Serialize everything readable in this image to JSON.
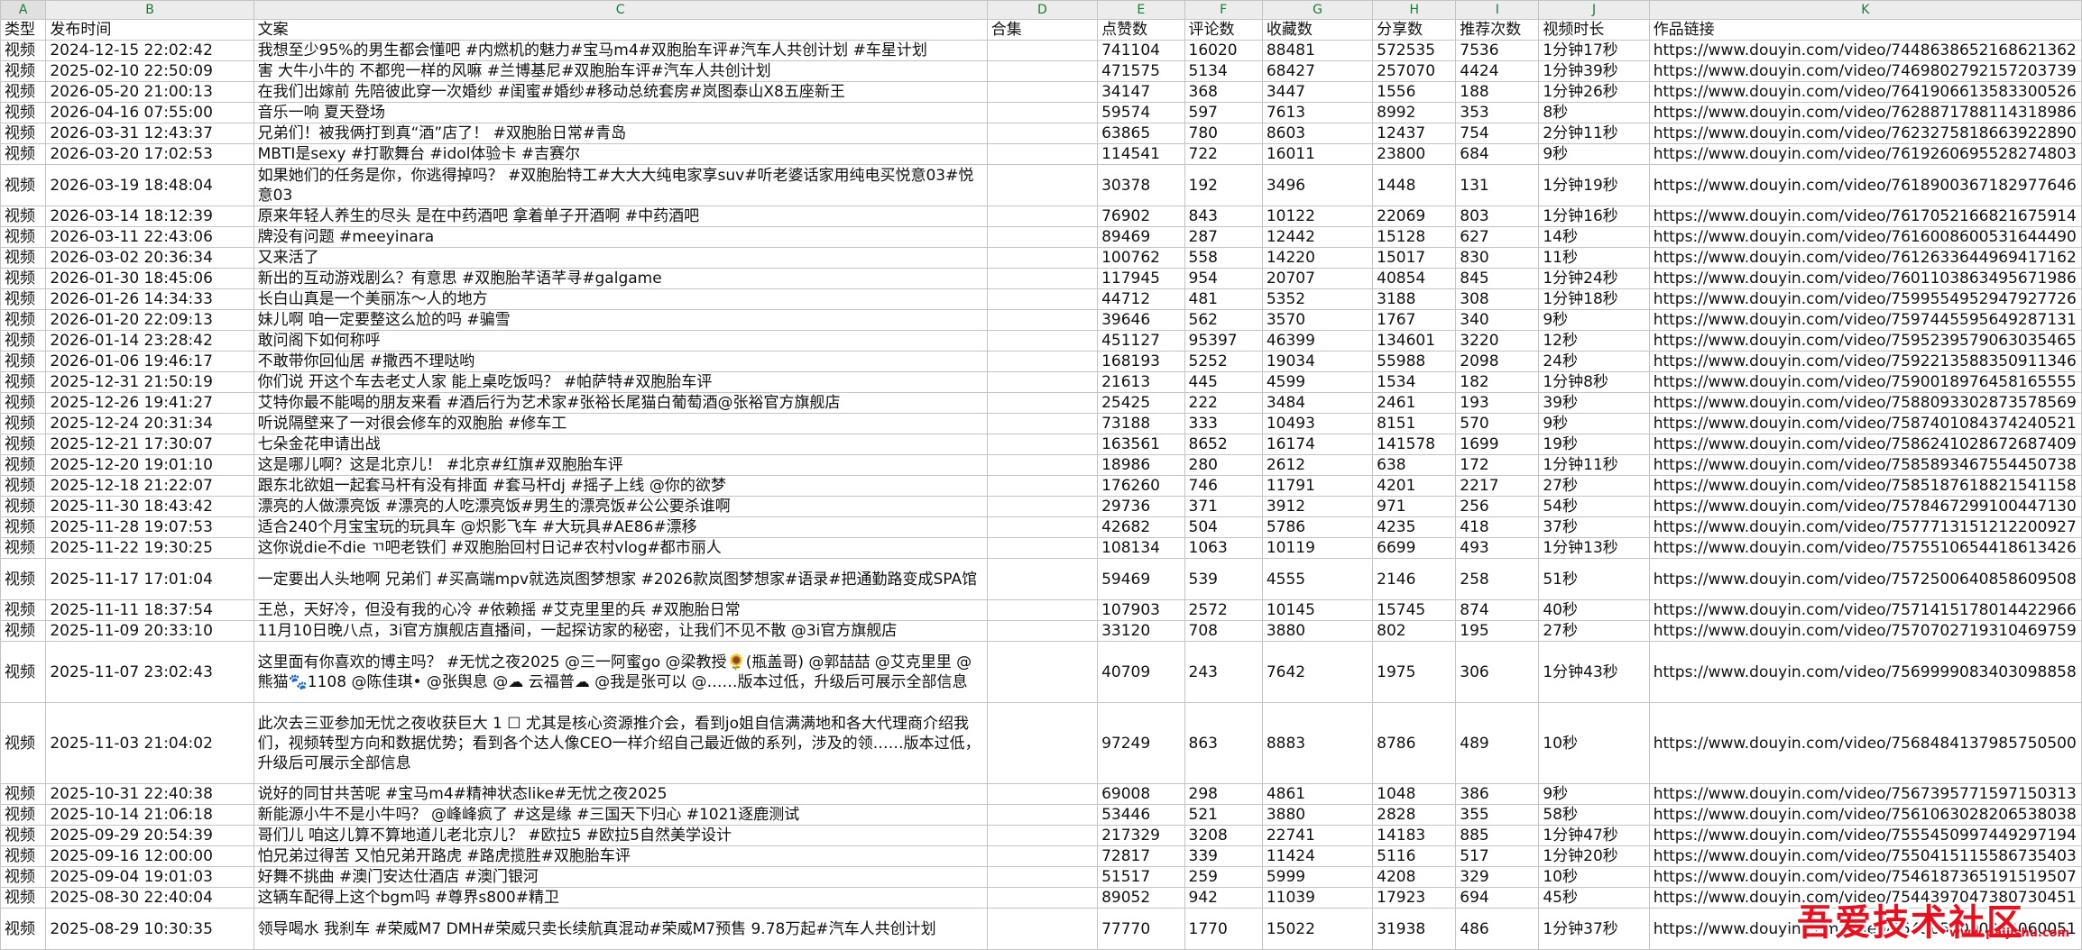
{
  "sheet": {
    "column_letters": [
      "A",
      "B",
      "C",
      "D",
      "E",
      "F",
      "G",
      "H",
      "I",
      "J",
      "K"
    ],
    "headers": [
      "类型",
      "发布时间",
      "文案",
      "合集",
      "点赞数",
      "评论数",
      "收藏数",
      "分享数",
      "推荐次数",
      "视频时长",
      "作品链接"
    ],
    "rows": [
      [
        "视频",
        "2024-12-15 22:02:42",
        "我想至少95%的男生都会懂吧 #内燃机的魅力#宝马m4#双胞胎车评#汽车人共创计划 #车星计划",
        "",
        "741104",
        "16020",
        "88481",
        "572535",
        "7536",
        "1分钟17秒",
        "https://www.douyin.com/video/7448638652168621362"
      ],
      [
        "视频",
        "2025-02-10 22:50:09",
        "害 大牛小牛的 不都兜一样的风嘛 #兰博基尼#双胞胎车评#汽车人共创计划",
        "",
        "471575",
        "5134",
        "68427",
        "257070",
        "4424",
        "1分钟39秒",
        "https://www.douyin.com/video/7469802792157203739"
      ],
      [
        "视频",
        "2026-05-20 21:00:13",
        "在我们出嫁前 先陪彼此穿一次婚纱 #闺蜜#婚纱#移动总统套房#岚图泰山X8五座新王",
        "",
        "34147",
        "368",
        "3447",
        "1556",
        "188",
        "1分钟26秒",
        "https://www.douyin.com/video/7641906613583300526"
      ],
      [
        "视频",
        "2026-04-16 07:55:00",
        "音乐一响 夏天登场",
        "",
        "59574",
        "597",
        "7613",
        "8992",
        "353",
        "8秒",
        "https://www.douyin.com/video/7628871788114318986"
      ],
      [
        "视频",
        "2026-03-31 12:43:37",
        "兄弟们！被我俩打到真“酒”店了！ #双胞胎日常#青岛",
        "",
        "63865",
        "780",
        "8603",
        "12437",
        "754",
        "2分钟11秒",
        "https://www.douyin.com/video/7623275818663922890"
      ],
      [
        "视频",
        "2026-03-20 17:02:53",
        "MBTI是sexy #打歌舞台 #idol体验卡 #吉赛尔",
        "",
        "114541",
        "722",
        "16011",
        "23800",
        "684",
        "9秒",
        "https://www.douyin.com/video/7619260695528274803"
      ],
      [
        "视频",
        "2026-03-19 18:48:04",
        "如果她们的任务是你，你逃得掉吗？ #双胞胎特工#大大大纯电家享suv#听老婆话家用纯电买悦意03#悦意03",
        "",
        "30378",
        "192",
        "3496",
        "1448",
        "131",
        "1分钟19秒",
        "https://www.douyin.com/video/7618900367182977646"
      ],
      [
        "视频",
        "2026-03-14 18:12:39",
        "原来年轻人养生的尽头 是在中药酒吧 拿着单子开酒啊 #中药酒吧",
        "",
        "76902",
        "843",
        "10122",
        "22069",
        "803",
        "1分钟16秒",
        "https://www.douyin.com/video/7617052166821675914"
      ],
      [
        "视频",
        "2026-03-11 22:43:06",
        "牌没有问题 #meeyinara",
        "",
        "89469",
        "287",
        "12442",
        "15128",
        "627",
        "14秒",
        "https://www.douyin.com/video/7616008600531644490"
      ],
      [
        "视频",
        "2026-03-02 20:36:34",
        "又来活了",
        "",
        "100762",
        "558",
        "14220",
        "15017",
        "830",
        "11秒",
        "https://www.douyin.com/video/7612633644969417162"
      ],
      [
        "视频",
        "2026-01-30 18:45:06",
        "新出的互动游戏剧么？有意思 #双胞胎芊语芊寻#galgame",
        "",
        "117945",
        "954",
        "20707",
        "40854",
        "845",
        "1分钟24秒",
        "https://www.douyin.com/video/7601103863495671986"
      ],
      [
        "视频",
        "2026-01-26 14:34:33",
        "长白山真是一个美丽冻～人的地方",
        "",
        "44712",
        "481",
        "5352",
        "3188",
        "308",
        "1分钟18秒",
        "https://www.douyin.com/video/7599554952947927726"
      ],
      [
        "视频",
        "2026-01-20 22:09:13",
        "妹儿啊 咱一定要整这么尬的吗 #骗雪",
        "",
        "39646",
        "562",
        "3570",
        "1767",
        "340",
        "9秒",
        "https://www.douyin.com/video/7597445595649287131"
      ],
      [
        "视频",
        "2026-01-14 23:28:42",
        "敢问阁下如何称呼",
        "",
        "451127",
        "95397",
        "46399",
        "134601",
        "3220",
        "12秒",
        "https://www.douyin.com/video/7595239579063035465"
      ],
      [
        "视频",
        "2026-01-06 19:46:17",
        "不敢带你回仙居 #撒西不理哒哟",
        "",
        "168193",
        "5252",
        "19034",
        "55988",
        "2098",
        "24秒",
        "https://www.douyin.com/video/7592213588350911346"
      ],
      [
        "视频",
        "2025-12-31 21:50:19",
        "你们说 开这个车去老丈人家 能上桌吃饭吗？ #帕萨特#双胞胎车评",
        "",
        "21613",
        "445",
        "4599",
        "1534",
        "182",
        "1分钟8秒",
        "https://www.douyin.com/video/7590018976458165555"
      ],
      [
        "视频",
        "2025-12-26 19:41:27",
        "艾特你最不能喝的朋友来看 #酒后行为艺术家#张裕长尾猫白葡萄酒@张裕官方旗舰店",
        "",
        "25425",
        "222",
        "3484",
        "2461",
        "193",
        "39秒",
        "https://www.douyin.com/video/7588093302873578569"
      ],
      [
        "视频",
        "2025-12-24 20:31:34",
        "听说隔壁来了一对很会修车的双胞胎 #修车工",
        "",
        "73188",
        "333",
        "10493",
        "8151",
        "570",
        "9秒",
        "https://www.douyin.com/video/7587401084374240521"
      ],
      [
        "视频",
        "2025-12-21 17:30:07",
        "七朵金花申请出战",
        "",
        "163561",
        "8652",
        "16174",
        "141578",
        "1699",
        "19秒",
        "https://www.douyin.com/video/7586241028672687409"
      ],
      [
        "视频",
        "2025-12-20 19:01:10",
        "这是哪儿啊？这是北京儿！ #北京#红旗#双胞胎车评",
        "",
        "18986",
        "280",
        "2612",
        "638",
        "172",
        "1分钟11秒",
        "https://www.douyin.com/video/7585893467554450738"
      ],
      [
        "视频",
        "2025-12-18 21:22:07",
        "跟东北欲姐一起套马杆有没有排面 #套马杆dj #摇子上线 @你的欲梦",
        "",
        "176260",
        "746",
        "11791",
        "4201",
        "2217",
        "27秒",
        "https://www.douyin.com/video/7585187618821541158"
      ],
      [
        "视频",
        "2025-11-30 18:43:42",
        "漂亮的人做漂亮饭 #漂亮的人吃漂亮饭#男生的漂亮饭#公公要杀谁啊",
        "",
        "29736",
        "371",
        "3912",
        "971",
        "256",
        "54秒",
        "https://www.douyin.com/video/7578467299100447130"
      ],
      [
        "视频",
        "2025-11-28 19:07:53",
        "适合240个月宝宝玩的玩具车 @炽影飞车 #大玩具#AE86#漂移",
        "",
        "42682",
        "504",
        "5786",
        "4235",
        "418",
        "37秒",
        "https://www.douyin.com/video/7577713151212200927"
      ],
      [
        "视频",
        "2025-11-22 19:30:25",
        "这你说die不die ㄲ吧老铁们 #双胞胎回村日记#农村vlog#都市丽人",
        "",
        "108134",
        "1063",
        "10119",
        "6699",
        "493",
        "1分钟13秒",
        "https://www.douyin.com/video/7575510654418613426"
      ],
      [
        "视频",
        "2025-11-17 17:01:04",
        "一定要出人头地啊 兄弟们 #买高端mpv就选岚图梦想家 #2026款岚图梦想家#语录#把通勤路变成SPA馆",
        "",
        "59469",
        "539",
        "4555",
        "2146",
        "258",
        "51秒",
        "https://www.douyin.com/video/7572500640858609508"
      ],
      [
        "视频",
        "2025-11-11 18:37:54",
        "王总，天好冷，但没有我的心冷 #依赖摇 #艾克里里的兵 #双胞胎日常",
        "",
        "107903",
        "2572",
        "10145",
        "15745",
        "874",
        "40秒",
        "https://www.douyin.com/video/7571415178014422966"
      ],
      [
        "视频",
        "2025-11-09 20:33:10",
        "11月10日晚八点，3i官方旗舰店直播间，一起探访家的秘密，让我们不见不散 @3i官方旗舰店",
        "",
        "33120",
        "708",
        "3880",
        "802",
        "195",
        "27秒",
        "https://www.douyin.com/video/7570702719310469759"
      ],
      [
        "视频",
        "2025-11-07 23:02:43",
        "这里面有你喜欢的博主吗？ #无忧之夜2025 @三一阿蜜go @梁教授🌻(瓶盖哥) @郭喆喆 @艾克里里 @熊猫🐾1108 @陈佳琪• @张舆息 @☁ 云福普☁ @我是张可以 @……版本过低，升级后可展示全部信息",
        "",
        "40709",
        "243",
        "7642",
        "1975",
        "306",
        "1分钟43秒",
        "https://www.douyin.com/video/7569999083403098858"
      ],
      [
        "视频",
        "2025-11-03 21:04:02",
        "此次去三亚参加无忧之夜收获巨大 1 ☐ 尤其是核心资源推介会，看到jo姐自信满满地和各大代理商介绍我们，视频转型方向和数据优势；看到各个达人像CEO一样介绍自己最近做的系列，涉及的领……版本过低，升级后可展示全部信息",
        "",
        "97249",
        "863",
        "8883",
        "8786",
        "489",
        "10秒",
        "https://www.douyin.com/video/7568484137985750500"
      ],
      [
        "视频",
        "2025-10-31 22:40:38",
        "说好的同甘共苦呢 #宝马m4#精神状态like#无忧之夜2025",
        "",
        "69008",
        "298",
        "4861",
        "1048",
        "386",
        "9秒",
        "https://www.douyin.com/video/7567395771597150313"
      ],
      [
        "视频",
        "2025-10-14 21:06:18",
        "新能源小牛不是小牛吗？ @峰峰疯了 #这是缘 #三国天下归心 #1021逐鹿测试",
        "",
        "53446",
        "521",
        "3880",
        "2828",
        "355",
        "58秒",
        "https://www.douyin.com/video/7561063028206538038"
      ],
      [
        "视频",
        "2025-09-29 20:54:39",
        "哥们儿 咱这儿算不算地道儿老北京儿？ #欧拉5 #欧拉5自然美学设计",
        "",
        "217329",
        "3208",
        "22741",
        "14183",
        "885",
        "1分钟47秒",
        "https://www.douyin.com/video/7555450997449297194"
      ],
      [
        "视频",
        "2025-09-16 12:00:00",
        "怕兄弟过得苦 又怕兄弟开路虎 #路虎揽胜#双胞胎车评",
        "",
        "72817",
        "339",
        "11424",
        "5116",
        "517",
        "1分钟20秒",
        "https://www.douyin.com/video/7550415115586735403"
      ],
      [
        "视频",
        "2025-09-04 19:01:03",
        "好舞不挑曲 #澳门安达仕酒店 #澳门银河",
        "",
        "51517",
        "259",
        "5999",
        "4208",
        "329",
        "10秒",
        "https://www.douyin.com/video/7546187365191519507"
      ],
      [
        "视频",
        "2025-08-30 22:40:04",
        "这辆车配得上这个bgm吗 #尊界s800#精卫",
        "",
        "89052",
        "942",
        "11039",
        "17923",
        "694",
        "45秒",
        "https://www.douyin.com/video/7544397047380730451"
      ],
      [
        "视频",
        "2025-08-29 10:30:35",
        "领导喝水 我刹车 #荣威M7 DMH#荣威只卖长续航真混动#荣威M7预售 9.78万起#汽车人共创计划",
        "",
        "77770",
        "1770",
        "15022",
        "31938",
        "486",
        "1分钟37秒",
        "https://www.douyin.com/video/7543657090370060051"
      ]
    ]
  },
  "watermark": {
    "text": "吾爱技术社区",
    "sub": "www.paijishu.com"
  }
}
